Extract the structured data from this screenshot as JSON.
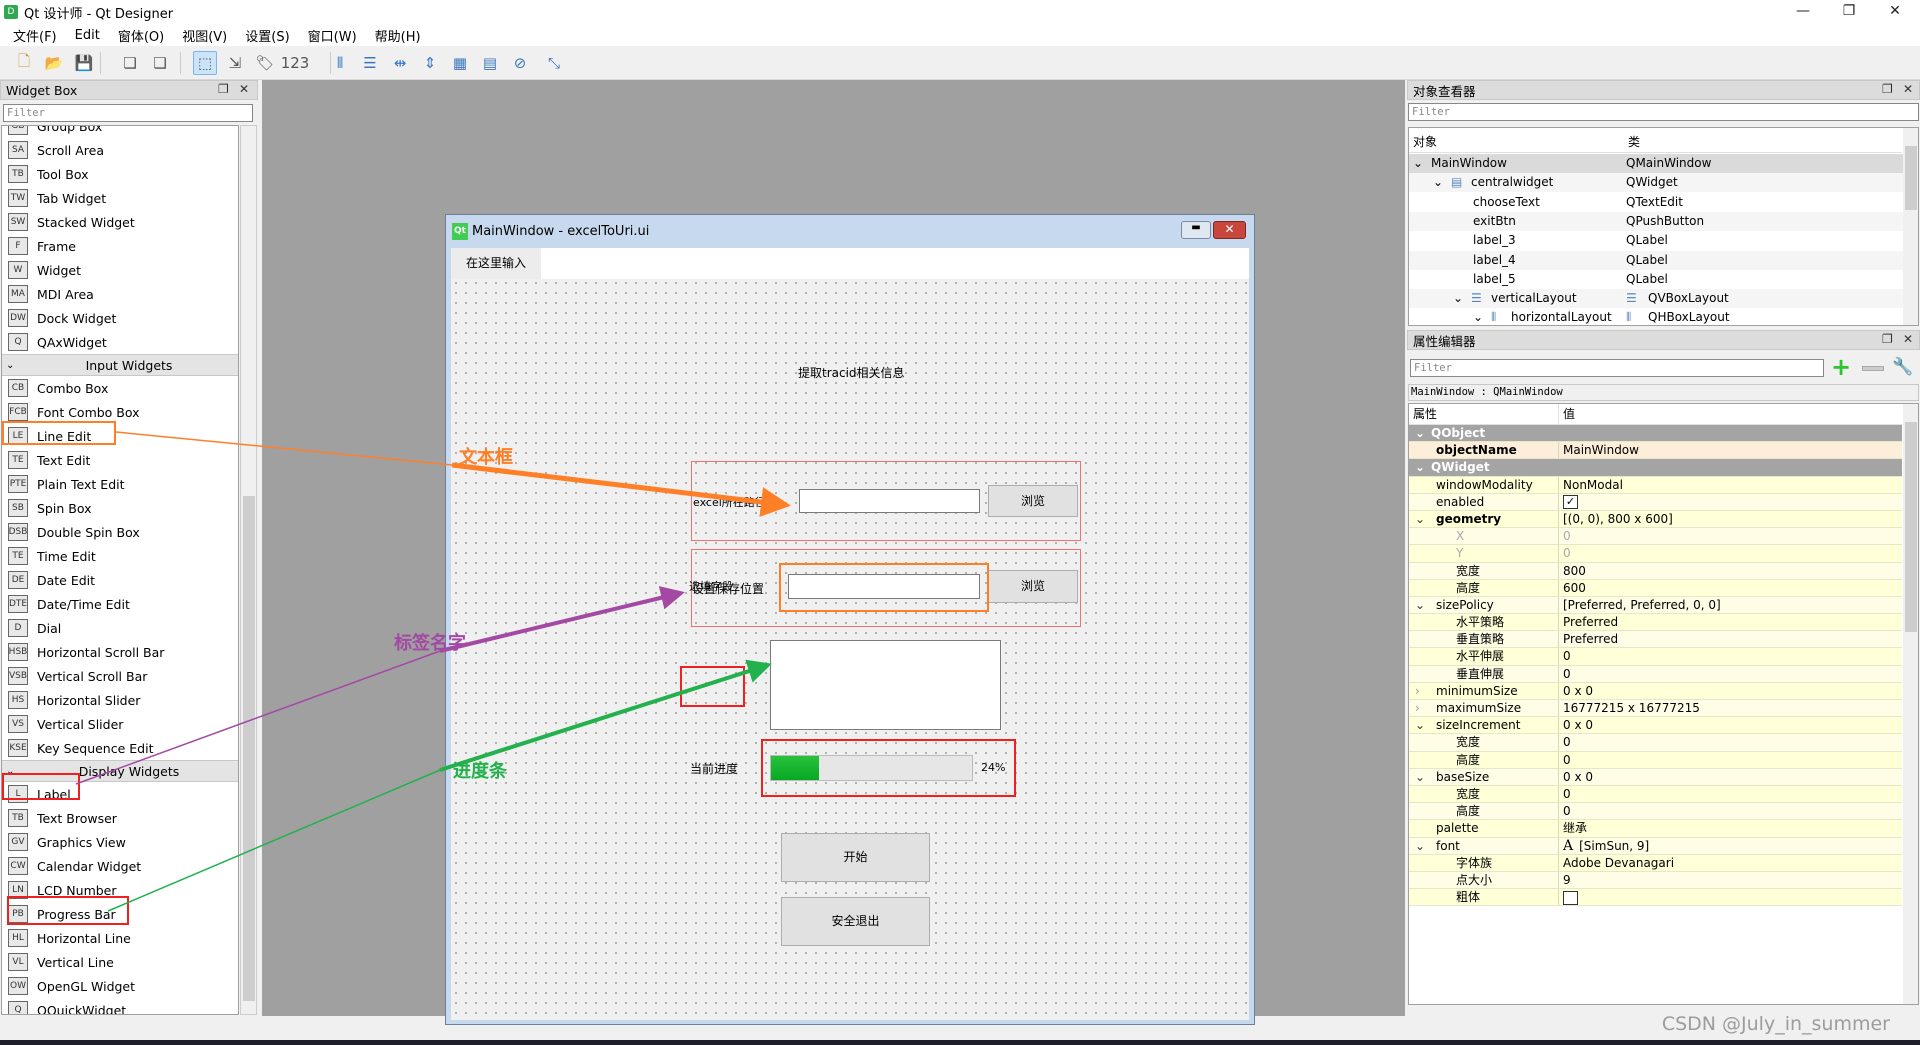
{
  "window": {
    "title": "Qt 设计师 - Qt Designer",
    "app_icon": "D"
  },
  "menubar": [
    "文件(F)",
    "Edit",
    "窗体(O)",
    "视图(V)",
    "设置(S)",
    "窗口(W)",
    "帮助(H)"
  ],
  "toolbar": [
    "new-file",
    "open-file",
    "save-file",
    "copy",
    "paste",
    "edit-widgets",
    "edit-signals-slots",
    "edit-buddies",
    "edit-tab-order",
    "layout-horizontal",
    "layout-vertical",
    "layout-h-splitter",
    "layout-v-splitter",
    "layout-grid",
    "layout-form",
    "break-layout",
    "adjust-size"
  ],
  "widget_box": {
    "title": "Widget Box",
    "filter_placeholder": "Filter",
    "sections": [
      {
        "header": null,
        "items": [
          "Group Box",
          "Scroll Area",
          "Tool Box",
          "Tab Widget",
          "Stacked Widget",
          "Frame",
          "Widget",
          "MDI Area",
          "Dock Widget",
          "QAxWidget"
        ]
      },
      {
        "header": "Input Widgets",
        "items": [
          "Combo Box",
          "Font Combo Box",
          "Line Edit",
          "Text Edit",
          "Plain Text Edit",
          "Spin Box",
          "Double Spin Box",
          "Time Edit",
          "Date Edit",
          "Date/Time Edit",
          "Dial",
          "Horizontal Scroll Bar",
          "Vertical Scroll Bar",
          "Horizontal Slider",
          "Vertical Slider",
          "Key Sequence Edit"
        ]
      },
      {
        "header": "Display Widgets",
        "items": [
          "Label",
          "Text Browser",
          "Graphics View",
          "Calendar Widget",
          "LCD Number",
          "Progress Bar",
          "Horizontal Line",
          "Vertical Line",
          "OpenGL Widget",
          "QQuickWidget"
        ]
      }
    ]
  },
  "form": {
    "title": "MainWindow - excelToUri.ui",
    "logo": "Qt",
    "menu_placeholder": "在这里输入",
    "heading": "提取tracid相关信息",
    "excel_path_label": "excel所在路径",
    "save_path_label": "设置保存位置",
    "browse_label": "浏览",
    "optional_field_label": "选填字段",
    "progress_label": "当前进度",
    "progress_value": 24,
    "progress_text": "24%",
    "start_button": "开始",
    "exit_button": "安全退出"
  },
  "annotations": {
    "textbox": {
      "text": "文本框",
      "color": "#ff7f27"
    },
    "label_name": {
      "text": "标签名字",
      "color": "#a349a4"
    },
    "progress": {
      "text": "进度条",
      "color": "#22b14c"
    },
    "highlight_red": "#ee2020"
  },
  "object_inspector": {
    "title": "对象查看器",
    "filter_placeholder": "Filter",
    "columns": [
      "对象",
      "类"
    ],
    "rows": [
      {
        "name": "MainWindow",
        "class": "QMainWindow",
        "depth": 0,
        "expanded": true,
        "selected": true
      },
      {
        "name": "centralwidget",
        "class": "QWidget",
        "depth": 1,
        "expanded": true,
        "icon": "widget-broken-layout"
      },
      {
        "name": "chooseText",
        "class": "QTextEdit",
        "depth": 2
      },
      {
        "name": "exitBtn",
        "class": "QPushButton",
        "depth": 2
      },
      {
        "name": "label_3",
        "class": "QLabel",
        "depth": 2
      },
      {
        "name": "label_4",
        "class": "QLabel",
        "depth": 2
      },
      {
        "name": "label_5",
        "class": "QLabel",
        "depth": 2
      },
      {
        "name": "verticalLayout",
        "class": "QVBoxLayout",
        "depth": 2,
        "expanded": true,
        "icon": "vbox-layout"
      },
      {
        "name": "horizontalLayout",
        "class": "QHBoxLayout",
        "depth": 3,
        "expanded": true,
        "icon": "hbox-layout"
      }
    ]
  },
  "property_editor": {
    "title": "属性编辑器",
    "filter_placeholder": "Filter",
    "context": "MainWindow : QMainWindow",
    "columns": [
      "属性",
      "值"
    ],
    "rows": [
      {
        "name": "QObject",
        "section": true
      },
      {
        "name": "objectName",
        "value": "MainWindow",
        "bold": true,
        "highlight": true
      },
      {
        "name": "QWidget",
        "section": true
      },
      {
        "name": "windowModality",
        "value": "NonModal"
      },
      {
        "name": "enabled",
        "checkbox": true,
        "checked": true
      },
      {
        "name": "geometry",
        "value": "[(0, 0), 800 x 600]",
        "bold": true,
        "expander": "open"
      },
      {
        "name": "X",
        "value": "0",
        "depth": 1,
        "dim": true
      },
      {
        "name": "Y",
        "value": "0",
        "depth": 1,
        "dim": true
      },
      {
        "name": "宽度",
        "value": "800",
        "depth": 1
      },
      {
        "name": "高度",
        "value": "600",
        "depth": 1
      },
      {
        "name": "sizePolicy",
        "value": "[Preferred, Preferred, 0, 0]",
        "expander": "open"
      },
      {
        "name": "水平策略",
        "value": "Preferred",
        "depth": 1
      },
      {
        "name": "垂直策略",
        "value": "Preferred",
        "depth": 1
      },
      {
        "name": "水平伸展",
        "value": "0",
        "depth": 1
      },
      {
        "name": "垂直伸展",
        "value": "0",
        "depth": 1
      },
      {
        "name": "minimumSize",
        "value": "0 x 0",
        "expander": "closed"
      },
      {
        "name": "maximumSize",
        "value": "16777215 x 16777215",
        "expander": "closed"
      },
      {
        "name": "sizeIncrement",
        "value": "0 x 0",
        "expander": "open"
      },
      {
        "name": "宽度",
        "value": "0",
        "depth": 1
      },
      {
        "name": "高度",
        "value": "0",
        "depth": 1
      },
      {
        "name": "baseSize",
        "value": "0 x 0",
        "expander": "open"
      },
      {
        "name": "宽度",
        "value": "0",
        "depth": 1
      },
      {
        "name": "高度",
        "value": "0",
        "depth": 1
      },
      {
        "name": "palette",
        "value": "继承"
      },
      {
        "name": "font",
        "value": "[SimSun, 9]",
        "expander": "open",
        "font_icon": "A"
      },
      {
        "name": "字体族",
        "value": "Adobe Devanagari",
        "depth": 1
      },
      {
        "name": "点大小",
        "value": "9",
        "depth": 1
      },
      {
        "name": "粗体",
        "checkbox": true,
        "checked": false,
        "depth": 1
      }
    ]
  },
  "watermark": "CSDN @July_in_summer"
}
